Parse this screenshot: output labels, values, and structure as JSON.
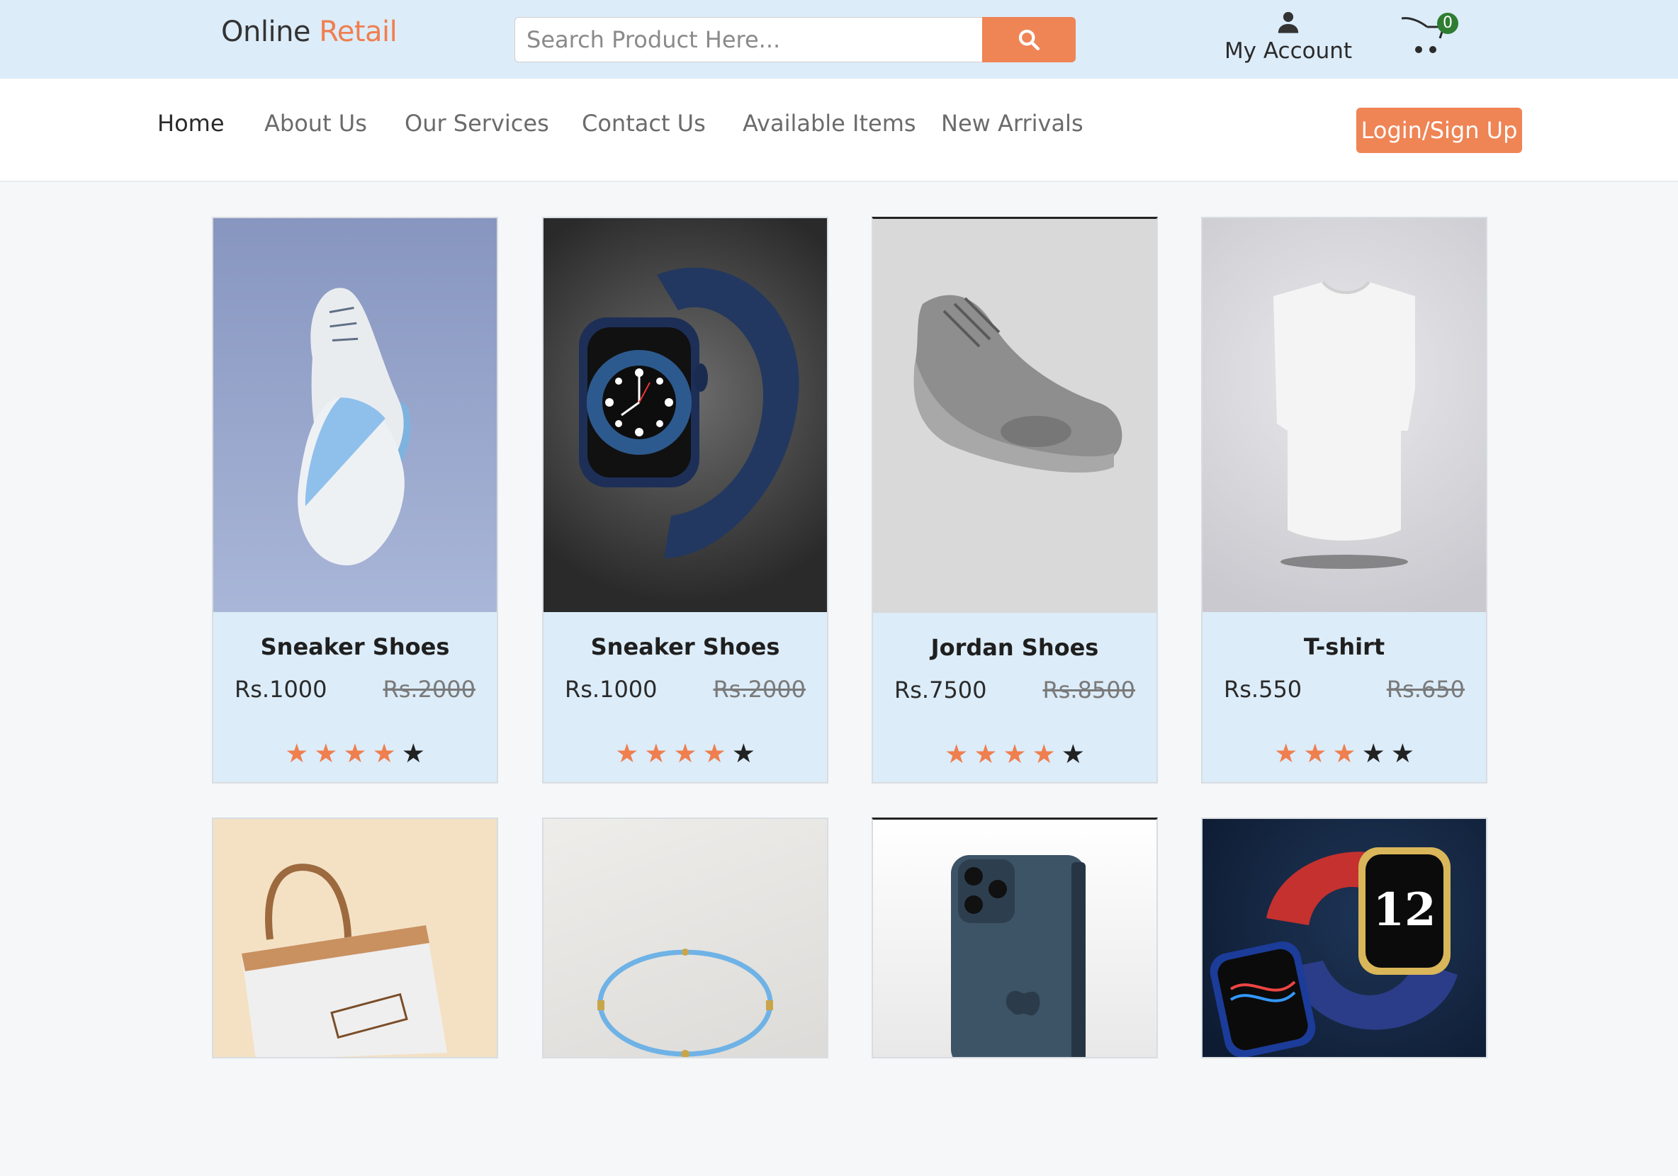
{
  "brand": {
    "part1": "Online",
    "part2": "Retail"
  },
  "search": {
    "placeholder": "Search Product Here..."
  },
  "account": {
    "label": "My Account"
  },
  "cart": {
    "count": "0"
  },
  "nav": {
    "items": [
      {
        "label": "Home"
      },
      {
        "label": "About Us"
      },
      {
        "label": "Our Services"
      },
      {
        "label": "Contact Us"
      },
      {
        "label": "Available Items"
      },
      {
        "label": "New Arrivals"
      }
    ],
    "login_label": "Login/Sign Up"
  },
  "products": [
    {
      "name": "Sneaker Shoes",
      "price": "Rs.1000",
      "old_price": "Rs.2000",
      "rating": 4
    },
    {
      "name": "Sneaker Shoes",
      "price": "Rs.1000",
      "old_price": "Rs.2000",
      "rating": 4
    },
    {
      "name": "Jordan Shoes",
      "price": "Rs.7500",
      "old_price": "Rs.8500",
      "rating": 4
    },
    {
      "name": "T-shirt",
      "price": "Rs.550",
      "old_price": "Rs.650",
      "rating": 3
    }
  ],
  "second_row_images": [
    "handbag-image",
    "bracelet-image",
    "phone-image",
    "watch-image"
  ],
  "colors": {
    "accent": "#ef8455",
    "header_bg": "#dcecf9",
    "card_bg": "#dcecf9",
    "badge": "#2e7d32"
  }
}
